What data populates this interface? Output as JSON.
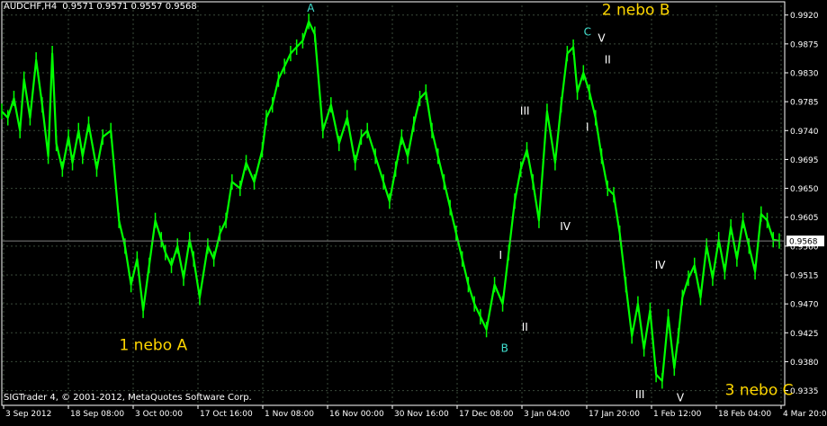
{
  "header": {
    "symbol": "AUDCHF,H4",
    "ohlc": "0.9571 0.9571 0.9557 0.9568"
  },
  "footer": {
    "copyright": "SIGTrader 4, © 2001-2012, MetaQuotes Software Corp."
  },
  "colors": {
    "background": "#000000",
    "price": "#00ff00",
    "grid": "#3a4a3a",
    "axis": "#ffffff",
    "label_yellow": "#ffd700",
    "label_cyan": "#40e0d0"
  },
  "chart_data": {
    "type": "line",
    "title": "",
    "xlabel": "",
    "ylabel": "",
    "ylim": [
      0.9312,
      0.9935
    ],
    "grid": true,
    "current_price": "0.9568",
    "y_ticks": [
      "0.9920",
      "0.9875",
      "0.9830",
      "0.9785",
      "0.9740",
      "0.9695",
      "0.9650",
      "0.9605",
      "0.9560",
      "0.9515",
      "0.9470",
      "0.9425",
      "0.9380",
      "0.9335"
    ],
    "x_ticks": [
      "3 Sep 2012",
      "18 Sep 08:00",
      "3 Oct 00:00",
      "17 Oct 16:00",
      "1 Nov 08:00",
      "16 Nov 00:00",
      "30 Nov 16:00",
      "17 Dec 08:00",
      "3 Jan 04:00",
      "17 Jan 20:00",
      "1 Feb 12:00",
      "18 Feb 04:00",
      "4 Mar 20:00"
    ],
    "series": [
      {
        "bar_index": [
          0,
          6,
          12,
          18,
          22,
          28,
          34,
          40,
          46,
          50,
          54,
          60,
          66,
          70,
          76,
          80,
          86,
          94,
          100,
          108,
          116,
          122,
          128,
          134,
          140,
          146,
          152,
          158,
          162,
          168,
          174,
          180,
          186,
          190,
          196,
          204,
          210,
          216,
          222,
          228,
          236,
          242,
          250,
          258,
          262,
          268,
          274,
          280,
          286,
          292,
          298,
          304,
          310,
          318,
          326,
          334,
          342,
          350,
          356,
          362,
          370,
          378,
          384,
          390,
          396,
          402,
          408,
          414,
          420,
          426,
          432,
          438,
          444,
          450,
          456,
          462,
          468,
          474,
          480,
          488,
          496,
          502,
          508,
          514,
          520,
          526,
          532,
          540,
          548,
          554,
          560,
          566,
          570,
          576,
          582,
          588,
          594,
          600,
          606,
          612,
          618,
          624,
          630,
          636,
          642,
          648,
          654,
          660,
          666,
          670,
          674,
          680,
          686,
          692,
          698,
          704,
          710,
          716,
          722,
          728,
          734,
          740,
          746,
          752,
          758,
          764,
          770
        ],
        "values": [
          0.977,
          0.976,
          0.979,
          0.974,
          0.982,
          0.976,
          0.985,
          0.978,
          0.97,
          0.986,
          0.972,
          0.968,
          0.973,
          0.969,
          0.974,
          0.97,
          0.975,
          0.968,
          0.973,
          0.974,
          0.96,
          0.956,
          0.95,
          0.954,
          0.946,
          0.953,
          0.96,
          0.957,
          0.955,
          0.953,
          0.956,
          0.951,
          0.957,
          0.954,
          0.948,
          0.956,
          0.954,
          0.958,
          0.96,
          0.966,
          0.965,
          0.969,
          0.966,
          0.971,
          0.976,
          0.978,
          0.982,
          0.984,
          0.986,
          0.987,
          0.988,
          0.991,
          0.989,
          0.974,
          0.978,
          0.972,
          0.976,
          0.969,
          0.973,
          0.974,
          0.97,
          0.966,
          0.963,
          0.968,
          0.973,
          0.97,
          0.975,
          0.979,
          0.98,
          0.974,
          0.97,
          0.966,
          0.962,
          0.958,
          0.954,
          0.95,
          0.947,
          0.945,
          0.943,
          0.95,
          0.947,
          0.955,
          0.963,
          0.968,
          0.971,
          0.966,
          0.96,
          0.977,
          0.969,
          0.978,
          0.986,
          0.987,
          0.98,
          0.983,
          0.98,
          0.976,
          0.97,
          0.965,
          0.964,
          0.958,
          0.95,
          0.942,
          0.947,
          0.94,
          0.946,
          0.936,
          0.935,
          0.945,
          0.937,
          0.942,
          0.948,
          0.951,
          0.953,
          0.948,
          0.956,
          0.951,
          0.957,
          0.952,
          0.959,
          0.954,
          0.96,
          0.956,
          0.952,
          0.961,
          0.96,
          0.957,
          0.9568
        ]
      }
    ],
    "annotations": [
      {
        "text": "A",
        "color": "#40e0d0",
        "bar_index": 306,
        "y": 0.9925
      },
      {
        "text": "1 nebo A",
        "color": "#ffd700",
        "bar_index": 150,
        "y": 0.9398
      },
      {
        "text": "2 nebo B",
        "color": "#ffd700",
        "bar_index": 628,
        "y": 0.992
      },
      {
        "text": "B",
        "color": "#40e0d0",
        "bar_index": 498,
        "y": 0.9395
      },
      {
        "text": "C",
        "color": "#40e0d0",
        "bar_index": 580,
        "y": 0.9888
      },
      {
        "text": "V",
        "color": "#ffffff",
        "bar_index": 594,
        "y": 0.9878
      },
      {
        "text": "II",
        "color": "#ffffff",
        "bar_index": 600,
        "y": 0.9845
      },
      {
        "text": "III",
        "color": "#ffffff",
        "bar_index": 518,
        "y": 0.9765
      },
      {
        "text": "I",
        "color": "#ffffff",
        "bar_index": 580,
        "y": 0.974
      },
      {
        "text": "IV",
        "color": "#ffffff",
        "bar_index": 558,
        "y": 0.9585
      },
      {
        "text": "I",
        "color": "#ffffff",
        "bar_index": 494,
        "y": 0.954
      },
      {
        "text": "II",
        "color": "#ffffff",
        "bar_index": 518,
        "y": 0.9428
      },
      {
        "text": "IV",
        "color": "#ffffff",
        "bar_index": 652,
        "y": 0.9525
      },
      {
        "text": "III",
        "color": "#ffffff",
        "bar_index": 632,
        "y": 0.9323
      },
      {
        "text": "V",
        "color": "#ffffff",
        "bar_index": 672,
        "y": 0.9318
      },
      {
        "text": "3 nebo C",
        "color": "#ffd700",
        "bar_index": 750,
        "y": 0.9328
      }
    ]
  }
}
